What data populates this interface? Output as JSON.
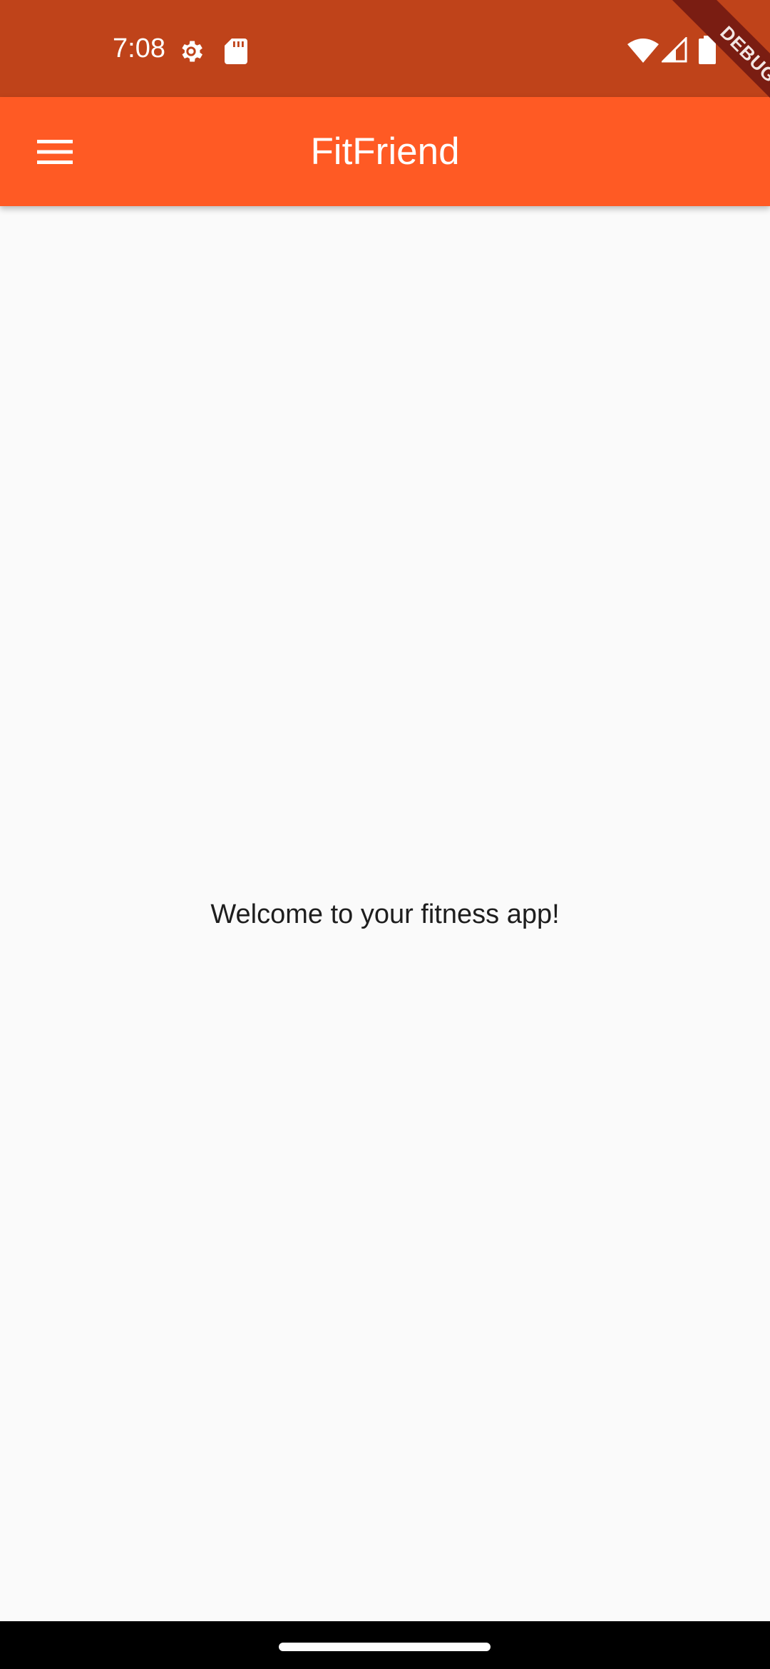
{
  "status_bar": {
    "time": "7:08",
    "icons": [
      "settings-gear-icon",
      "sd-card-icon",
      "wifi-icon",
      "cellular-signal-icon",
      "battery-icon"
    ],
    "color": "#bf431a"
  },
  "debug_banner": {
    "label": "DEBUG"
  },
  "app_bar": {
    "title": "FitFriend",
    "menu_icon": "hamburger-menu-icon",
    "color": "#ff5a24"
  },
  "main": {
    "welcome_text": "Welcome to your fitness app!",
    "background": "#fafafa"
  },
  "nav_bar": {
    "home_indicator": "home-pill"
  }
}
